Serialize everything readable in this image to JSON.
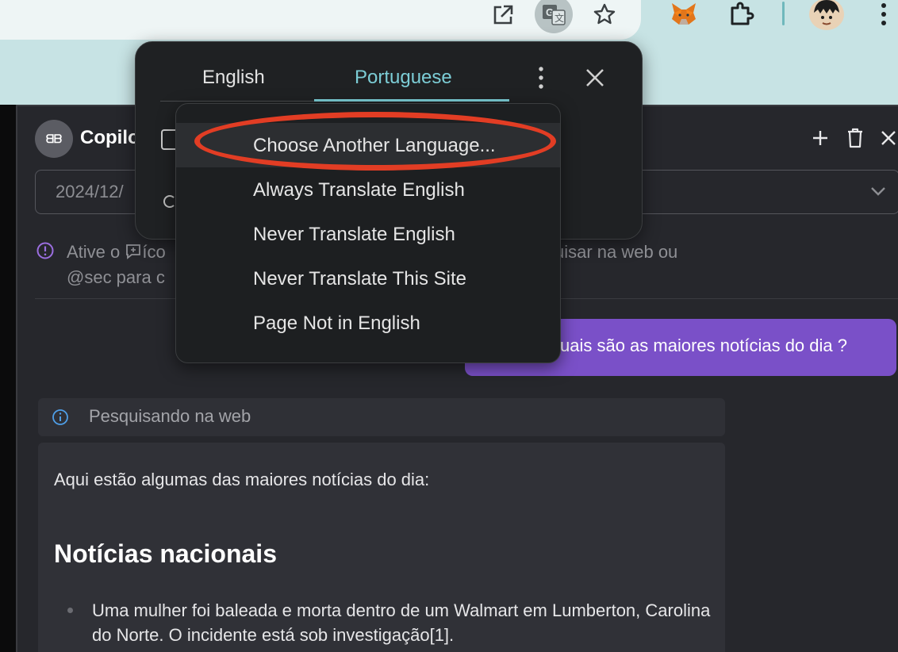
{
  "browser": {
    "toolbar_icons": [
      "open-in-new-icon",
      "translate-icon",
      "bookmark-star-icon",
      "metamask-fox-icon",
      "extensions-puzzle-icon",
      "profile-avatar",
      "more-vert-icon"
    ]
  },
  "translate_popup": {
    "tabs": [
      {
        "label": "English",
        "active": false
      },
      {
        "label": "Portuguese",
        "active": true
      }
    ],
    "accent_color": "#7ccdd6"
  },
  "options_menu": {
    "items": [
      {
        "label": "Choose Another Language...",
        "highlighted": true
      },
      {
        "label": "Always Translate English",
        "highlighted": false
      },
      {
        "label": "Never Translate English",
        "highlighted": false
      },
      {
        "label": "Never Translate This Site",
        "highlighted": false
      },
      {
        "label": "Page Not in English",
        "highlighted": false
      }
    ],
    "annotation_color": "#e23d24"
  },
  "app": {
    "logo_text": "ᗺᗷ",
    "title": "Copilo",
    "date_value": "2024/12/",
    "info_text_part1": "Ative o ",
    "info_text_mid": "íco",
    "info_text_part2": "use @web para pesquisar na web ou",
    "info_text_line2": "@sec para c",
    "user_message": "uais são as maiores notícias do dia ?",
    "user_bubble_color": "#7a50c8",
    "search_status": "Pesquisando na web",
    "answer_intro": "Aqui estão algumas das maiores notícias do dia:",
    "answer_heading": "Notícias nacionais",
    "answer_item": "Uma mulher foi baleada e morta dentro de um Walmart em Lumberton, Carolina do Norte. O incidente está sob investigação[1]."
  }
}
